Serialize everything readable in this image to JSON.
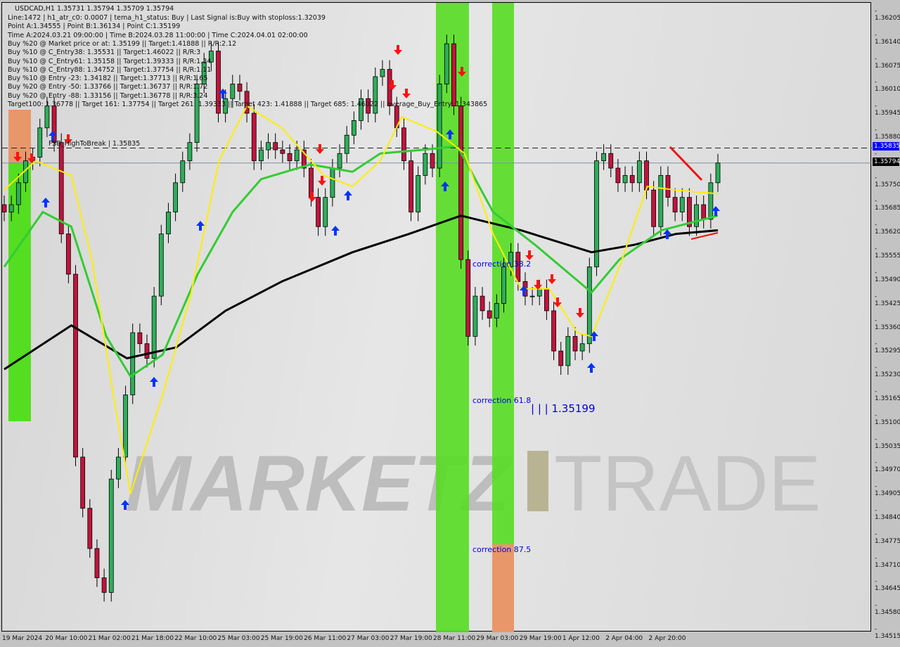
{
  "header": {
    "symbol_line": "USDCAD,H1  1.35731 1.35794 1.35709 1.35794",
    "info_lines": [
      "Line:1472 | h1_atr_c0: 0.0007 | tema_h1_status: Buy | Last Signal is:Buy with stoploss:1.32039",
      "Point A:1.34555 | Point B:1.36134 | Point C:1.35199",
      "Time A:2024.03.21 09:00:00 | Time B:2024.03.28 11:00:00 | Time C:2024.04.01 02:00:00",
      "Buy %20 @ Market price or at: 1.35199 || Target:1.41888 || R/R:2.12",
      "Buy %10 @ C_Entry38: 1.35531 || Target:1.46022 || R/R:3",
      "Buy %10 @ C_Entry61: 1.35158 || Target:1.39333 || R/R:1.34",
      "Buy %10 @ C_Entry88: 1.34752 || Target:1.37754 || R/R:1.11",
      "Buy %10 @ Entry -23: 1.34182 || Target:1.37713 || R/R:1.65",
      "Buy %20 @ Entry -50: 1.33766 || Target:1.36737 || R/R:1.72",
      "Buy %20 @ Entry -88: 1.33156 || Target:1.36778 || R/R:3.24",
      "Target100: 1.36778 || Target 161: 1.37754 || Target 261: 1.39333 || Target 423: 1.41888 || Target 685: 1.46022 || average_Buy_Entry: 1.343865"
    ]
  },
  "labels": {
    "fsb": "FSB_HighToBreak | 1.35835",
    "corr38": "correction 38.2",
    "corr61": "correction 61.8",
    "corr87": "correction 87.5",
    "pointc": "| | | 1.35199",
    "watermark_left": "MARKETZ",
    "watermark_right": "TRADE"
  },
  "colors": {
    "bull": "#2eae5a",
    "bear": "#c0143c",
    "ma_fast": "#ffee00",
    "ma_mid": "#33cc33",
    "ma_slow": "#000000",
    "band_green": "#55dd22",
    "band_orange": "#e8976a",
    "fsb_line": "#0000ff",
    "signal_up": "#0033ff",
    "signal_down": "#ff1111"
  },
  "chart_data": {
    "type": "candlestick",
    "symbol": "USDCAD",
    "timeframe": "H1",
    "ylim": [
      1.34515,
      1.36205
    ],
    "y_ticks": [
      "1.36205",
      "1.36140",
      "1.36075",
      "1.36010",
      "1.35945",
      "1.35880",
      "1.35815",
      "1.35750",
      "1.35685",
      "1.35620",
      "1.35555",
      "1.35490",
      "1.35425",
      "1.35360",
      "1.35295",
      "1.35230",
      "1.35165",
      "1.35100",
      "1.35035",
      "1.34970",
      "1.34905",
      "1.34840",
      "1.34775",
      "1.34710",
      "1.34645",
      "1.34580",
      "1.34515"
    ],
    "x_ticks": [
      "19 Mar 2024",
      "20 Mar 10:00",
      "21 Mar 02:00",
      "21 Mar 18:00",
      "22 Mar 10:00",
      "25 Mar 03:00",
      "25 Mar 19:00",
      "26 Mar 11:00",
      "27 Mar 03:00",
      "27 Mar 19:00",
      "28 Mar 11:00",
      "29 Mar 03:00",
      "29 Mar 19:00",
      "1 Apr 12:00",
      "2 Apr 04:00",
      "2 Apr 20:00"
    ],
    "close": [
      1.3566,
      1.3568,
      1.3574,
      1.358,
      1.3581,
      1.3589,
      1.3595,
      1.3585,
      1.356,
      1.3549,
      1.3499,
      1.3485,
      1.3474,
      1.3466,
      1.3462,
      1.3493,
      1.3499,
      1.3516,
      1.3533,
      1.353,
      1.3526,
      1.3543,
      1.356,
      1.3566,
      1.3574,
      1.358,
      1.3585,
      1.3601,
      1.3607,
      1.361,
      1.3593,
      1.3597,
      1.3601,
      1.3599,
      1.3593,
      1.358,
      1.3583,
      1.3585,
      1.3583,
      1.3582,
      1.358,
      1.3583,
      1.3578,
      1.357,
      1.3562,
      1.357,
      1.3578,
      1.3582,
      1.3587,
      1.3591,
      1.3597,
      1.3593,
      1.3603,
      1.3605,
      1.3595,
      1.3589,
      1.358,
      1.3566,
      1.3576,
      1.3582,
      1.3578,
      1.3601,
      1.3612,
      1.3595,
      1.3553,
      1.3532,
      1.3543,
      1.3539,
      1.3537,
      1.3541,
      1.3551,
      1.3555,
      1.3547,
      1.3543,
      1.3543,
      1.3545,
      1.3539,
      1.3528,
      1.3524,
      1.3532,
      1.3528,
      1.353,
      1.3551,
      1.358,
      1.3582,
      1.3578,
      1.3574,
      1.3576,
      1.3574,
      1.358,
      1.3572,
      1.3562,
      1.3576,
      1.357,
      1.3566,
      1.357,
      1.3562,
      1.3568,
      1.3564,
      1.3574,
      1.35794
    ],
    "ma_fast": [
      [
        0,
        1.3572
      ],
      [
        4.4,
        1.358
      ],
      [
        9.4,
        1.3576
      ],
      [
        12.3,
        1.3553
      ],
      [
        15.3,
        1.3516
      ],
      [
        17.7,
        1.3489
      ],
      [
        22.2,
        1.3516
      ],
      [
        26.1,
        1.3543
      ],
      [
        30.1,
        1.358
      ],
      [
        34,
        1.3595
      ],
      [
        38.9,
        1.3589
      ],
      [
        44.8,
        1.3576
      ],
      [
        48.8,
        1.3573
      ],
      [
        52.7,
        1.358
      ],
      [
        55.7,
        1.3592
      ],
      [
        60.6,
        1.3588
      ],
      [
        64.5,
        1.3582
      ],
      [
        68.5,
        1.356
      ],
      [
        72.4,
        1.3545
      ],
      [
        76.4,
        1.3545
      ],
      [
        80.3,
        1.3533
      ],
      [
        82.3,
        1.3532
      ],
      [
        86.2,
        1.3551
      ],
      [
        90.1,
        1.3573
      ],
      [
        94.1,
        1.3572
      ],
      [
        100,
        1.3571
      ]
    ],
    "ma_mid": [
      [
        0,
        1.3551
      ],
      [
        5.4,
        1.3566
      ],
      [
        9.4,
        1.3562
      ],
      [
        14.3,
        1.3532
      ],
      [
        17.7,
        1.3521
      ],
      [
        22.2,
        1.3527
      ],
      [
        27.1,
        1.3549
      ],
      [
        32,
        1.3566
      ],
      [
        36,
        1.3575
      ],
      [
        42.9,
        1.3579
      ],
      [
        48.8,
        1.3577
      ],
      [
        52.7,
        1.3582
      ],
      [
        58.6,
        1.3583
      ],
      [
        63.5,
        1.3584
      ],
      [
        68.5,
        1.3566
      ],
      [
        74.4,
        1.3557
      ],
      [
        82.3,
        1.3544
      ],
      [
        86.2,
        1.3553
      ],
      [
        92.1,
        1.3561
      ],
      [
        100,
        1.3565
      ]
    ],
    "ma_slow": [
      [
        0,
        1.3523
      ],
      [
        9.4,
        1.3535
      ],
      [
        17.2,
        1.3526
      ],
      [
        24.1,
        1.3529
      ],
      [
        31,
        1.3539
      ],
      [
        38.9,
        1.3547
      ],
      [
        48.8,
        1.3555
      ],
      [
        56.7,
        1.356
      ],
      [
        64,
        1.3565
      ],
      [
        72.4,
        1.3561
      ],
      [
        82.3,
        1.3555
      ],
      [
        88.2,
        1.3557
      ],
      [
        94.1,
        1.356
      ],
      [
        100,
        1.3561
      ]
    ],
    "levels": {
      "fsb_high_to_break": 1.35835,
      "last_price": 1.35794,
      "point_c": 1.35199
    }
  }
}
